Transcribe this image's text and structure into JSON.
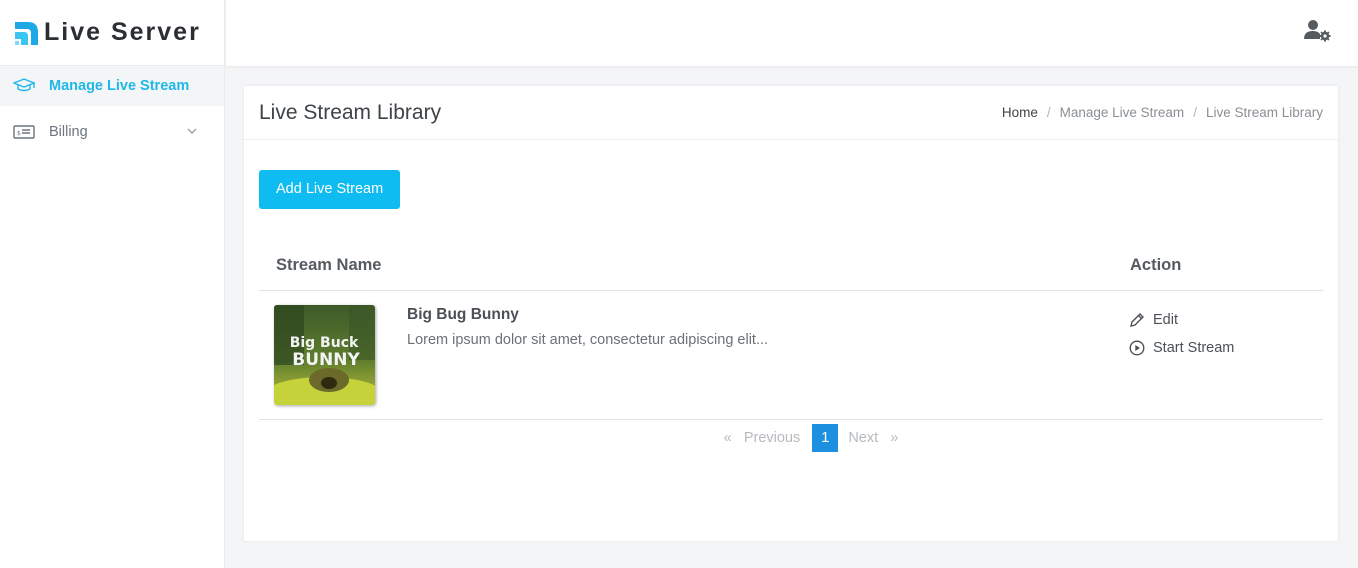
{
  "brand": {
    "name": "Live Server"
  },
  "sidebar": {
    "items": [
      {
        "label": "Manage Live Stream",
        "icon": "graduation-cap-icon",
        "active": true
      },
      {
        "label": "Billing",
        "icon": "ticket-icon",
        "active": false
      }
    ]
  },
  "topbar": {
    "user_icon": "user-settings-icon"
  },
  "page": {
    "title": "Live Stream Library",
    "breadcrumb": [
      "Home",
      "Manage Live Stream",
      "Live Stream Library"
    ],
    "breadcrumb_separator": "/"
  },
  "toolbar": {
    "add_label": "Add Live Stream"
  },
  "table": {
    "headers": {
      "name": "Stream Name",
      "action": "Action"
    },
    "rows": [
      {
        "thumbnail_text": [
          "Big Buck",
          "BUNNY"
        ],
        "name": "Big Bug Bunny",
        "description": "Lorem ipsum dolor sit amet, consectetur adipiscing elit...",
        "actions": {
          "edit": "Edit",
          "start": "Start Stream"
        }
      }
    ]
  },
  "pagination": {
    "prev_symbol": "«",
    "prev_label": "Previous",
    "current": "1",
    "next_label": "Next",
    "next_symbol": "»"
  },
  "colors": {
    "accent": "#0fbcf2",
    "active_nav": "#20b8e8",
    "page_active": "#1e90e0"
  }
}
